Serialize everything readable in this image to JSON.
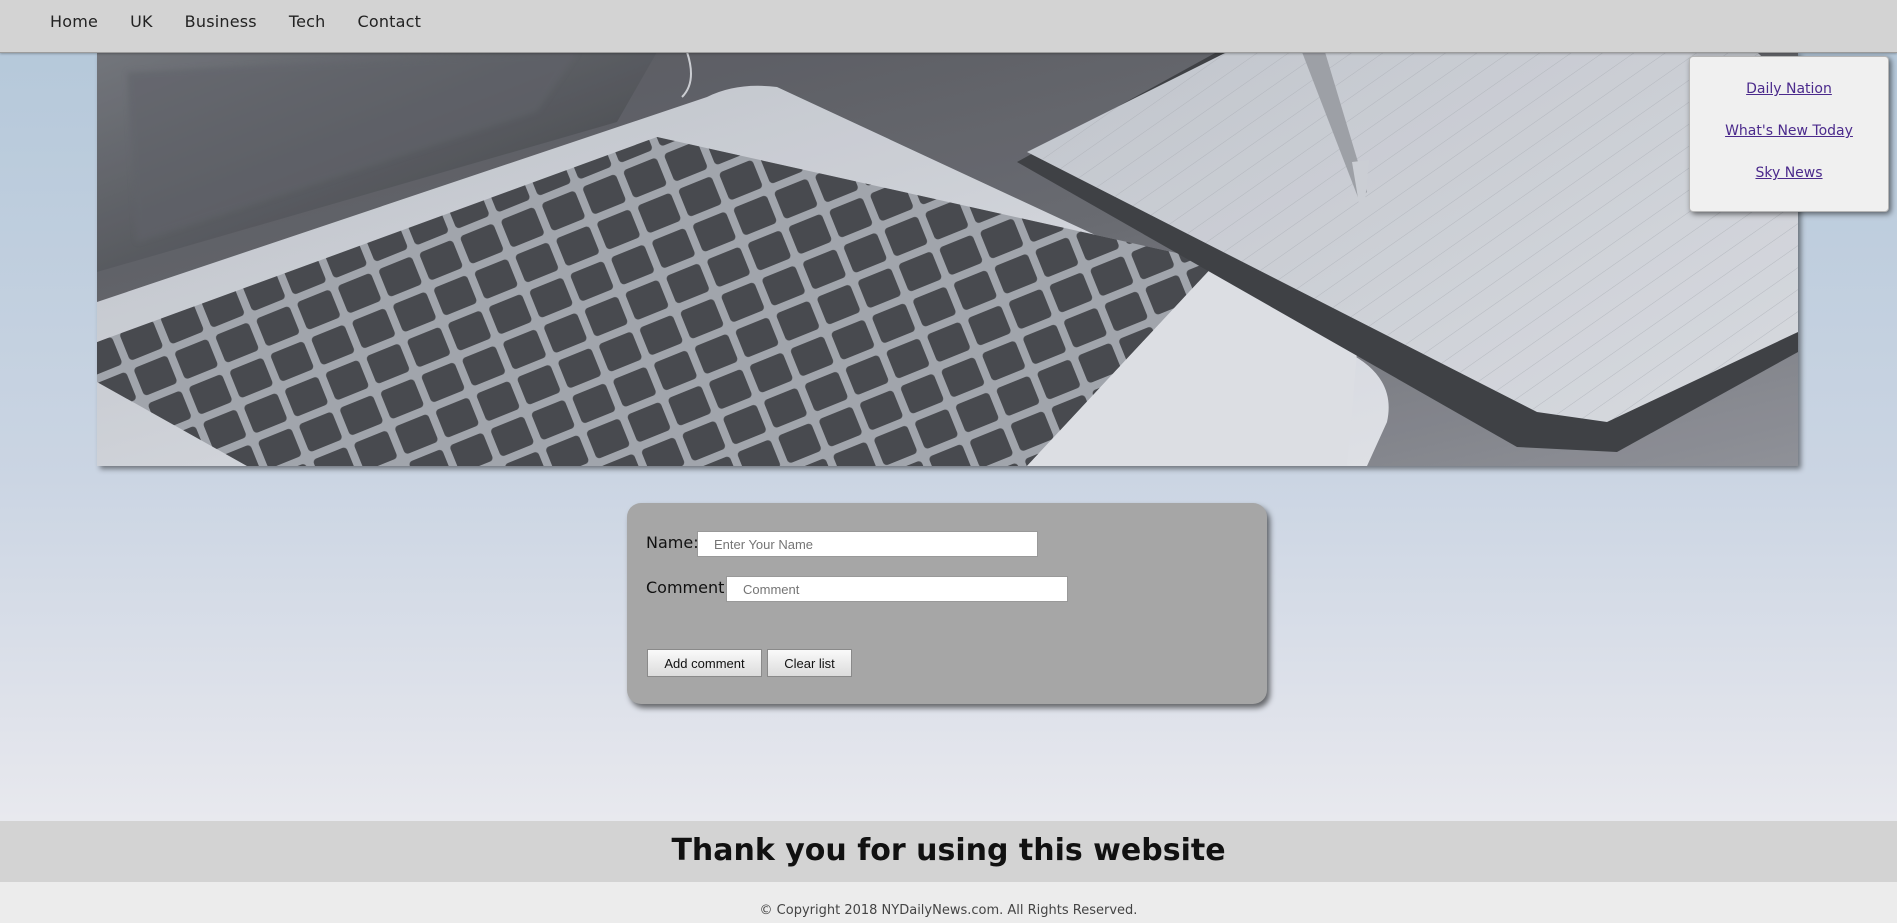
{
  "nav": {
    "items": [
      "Home",
      "UK",
      "Business",
      "Tech",
      "Contact"
    ]
  },
  "side_links": {
    "items": [
      "Daily Nation",
      "What's New Today",
      "Sky News"
    ]
  },
  "form": {
    "name_label": "Name:",
    "name_placeholder": "Enter Your Name",
    "name_value": "",
    "comment_label": "Comment:",
    "comment_placeholder": "Comment",
    "comment_value": "",
    "add_button": "Add comment",
    "clear_button": "Clear list"
  },
  "footer": {
    "thank_you": "Thank you for using this website",
    "copyright": "© Copyright 2018 NYDailyNews.com. All Rights Reserved."
  },
  "colors": {
    "nav_bg": "#d3d3d3",
    "form_bg": "#a6a6a6",
    "link": "#4b2a8c"
  },
  "hero": {
    "image": "laptop-keyboard-and-notebook-photo"
  }
}
